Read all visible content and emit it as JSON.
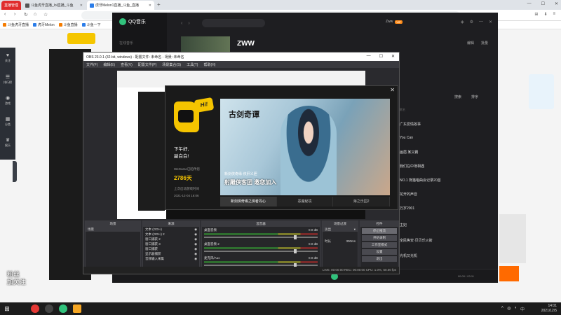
{
  "browser": {
    "tabs": [
      {
        "label": "直播管理",
        "color": "#e02c2c"
      },
      {
        "label": "斗鱼虎牙直播_lol直播_斗鱼",
        "color": "#555"
      },
      {
        "label": "虎牙Melon1直播_斗鱼_直播",
        "color": "#2b7de9"
      }
    ],
    "new_tab": "+",
    "bookmarks": [
      {
        "label": "斗鱼虎牙直播",
        "color": "#f57c00"
      },
      {
        "label": "虎牙Melon",
        "color": "#2b7de9"
      },
      {
        "label": "斗鱼直播",
        "color": "#f57c00"
      },
      {
        "label": "斗鱼一下",
        "color": "#2b7de9"
      }
    ]
  },
  "rail": [
    "关注",
    "排行榜",
    "游戏",
    "分类",
    "娱乐"
  ],
  "chat_overlay": {
    "line1": "粉丝",
    "line2": "加关注"
  },
  "qqmusic": {
    "app_name": "QQ音乐",
    "side_label": "在线音乐",
    "search_placeholder": "",
    "user": "Zww",
    "vip": "VIP",
    "artist": "ZWW",
    "links": [
      "编辑",
      "批量"
    ],
    "header_actions": [
      "搜索",
      "排序"
    ],
    "col_label": "歌名",
    "songs": [
      "广东爱情故事",
      "You Can",
      "画眉 某又霸",
      "我们在中场相遇",
      "NO.1 熊猫唱曲会记录20首",
      "花开的声音",
      "万岁2001",
      "主妃",
      "全民焦安·贝贝乐火箭",
      "光机又光机"
    ],
    "time": "00:00 / 03:11"
  },
  "obs": {
    "title": "OBS 23.0.1 (32-bit, windows) - 配置文件: 未命名 - 场景: 未命名",
    "menu": [
      "文件(F)",
      "编辑(E)",
      "查看(V)",
      "配置文件(P)",
      "场景集合(S)",
      "工具(T)",
      "帮助(H)"
    ],
    "docks": {
      "scenes": {
        "title": "场景",
        "items": [
          "场景"
        ]
      },
      "sources": {
        "title": "来源",
        "items": [
          "文本 (GDI+)",
          "文本 (GDI+) 2",
          "窗口捕获 2",
          "窗口捕获 3",
          "窗口捕获",
          "显示器捕获",
          "音频输入采集"
        ]
      },
      "mixer": {
        "title": "混音器",
        "channels": [
          {
            "name": "桌面音频",
            "db": "0.0 dB",
            "level": 0.85
          },
          {
            "name": "桌面音频 2",
            "db": "0.0 dB",
            "level": 0.85
          },
          {
            "name": "麦克风/Aux",
            "db": "0.0 dB",
            "level": 0.85
          }
        ]
      },
      "transitions": {
        "title": "场景过渡",
        "mode": "淡出",
        "duration_label": "时长",
        "duration": "300ms"
      },
      "controls": {
        "title": "控件",
        "buttons": [
          "停止推流",
          "开始录制",
          "工作室模式",
          "设置",
          "退出"
        ]
      }
    },
    "status": "LIVE: 00:00:00   REC: 00:00:00   CPU: 1.0%, 60.00 fps"
  },
  "popup": {
    "hi": "Hi!",
    "greet_line1": "下午好,",
    "greet_line2": "副白白!",
    "joined_label": "WeGame已陪伴您",
    "days": "2786天",
    "last_login_label": "上次启动游戏时间",
    "last_login": "2021-12-04 16:06",
    "banner_logo": "古剑奇谭",
    "banner_sub": "新剑侠奇缘·侠肝义胆",
    "banner_main": "射雕侠客团 邀您加入",
    "tabs": [
      "新剑侠奇缘之侠者丹心",
      "恶魔秘境",
      "海之乐园2"
    ]
  },
  "taskbar": {
    "time": "14:01",
    "date": "2021/12/5"
  }
}
